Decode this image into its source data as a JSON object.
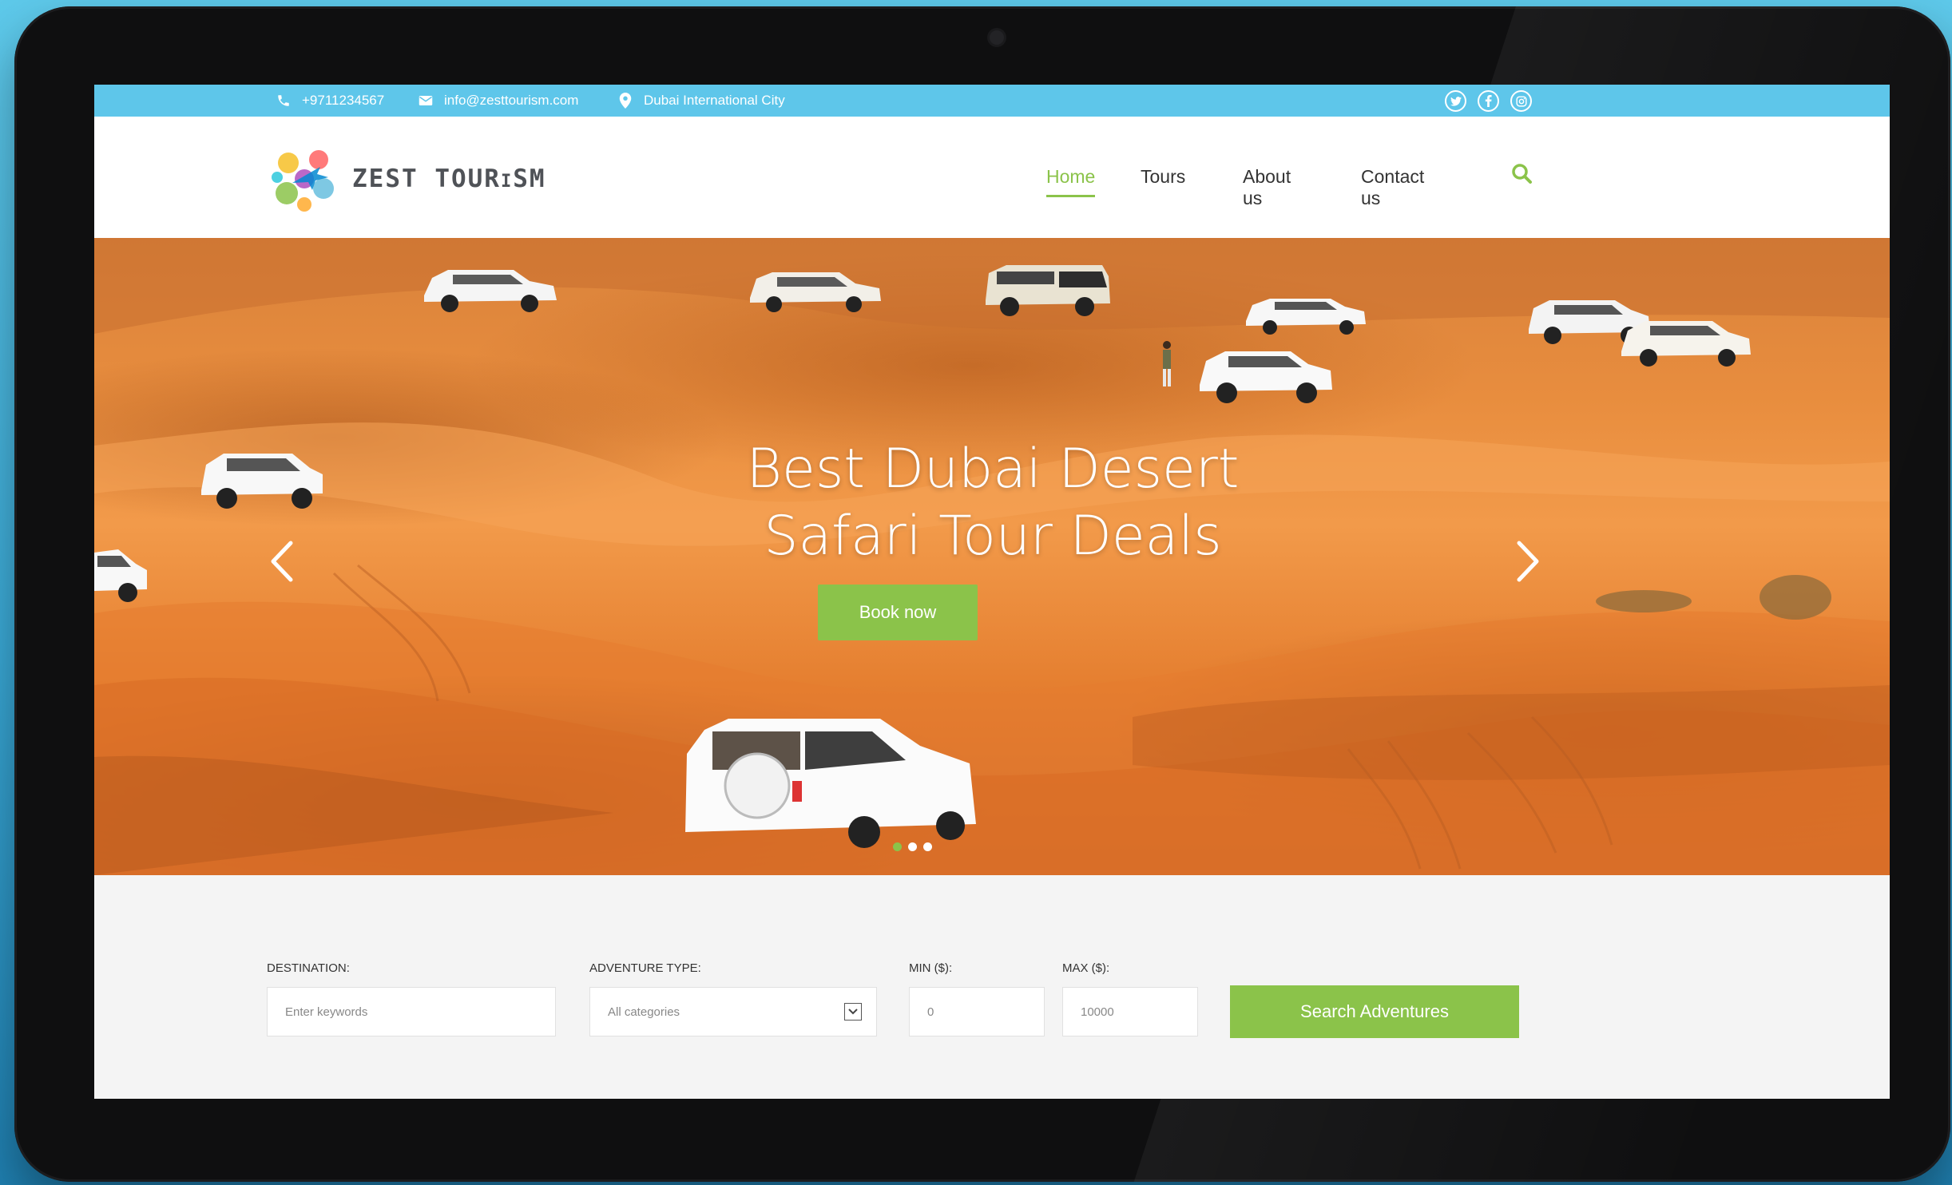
{
  "topbar": {
    "phone": "+9711234567",
    "email": "info@zesttourism.com",
    "location": "Dubai International City",
    "social": [
      "twitter-icon",
      "facebook-icon",
      "instagram-icon"
    ]
  },
  "header": {
    "logo_text": "ZEST TOURiSM"
  },
  "nav": {
    "items": [
      {
        "label": "Home",
        "active": true
      },
      {
        "label": "Tours",
        "active": false
      },
      {
        "label": "About us",
        "active": false
      },
      {
        "label": "Contact us",
        "active": false
      }
    ]
  },
  "hero": {
    "title_line1": "Best Dubai Desert",
    "title_line2": "Safari Tour Deals",
    "cta_label": "Book now",
    "slide_count": 3,
    "active_slide": 1
  },
  "search": {
    "destination_label": "DESTINATION:",
    "destination_placeholder": "Enter keywords",
    "type_label": "ADVENTURE TYPE:",
    "type_value": "All categories",
    "min_label": "MIN ($):",
    "min_value": "0",
    "max_label": "MAX ($):",
    "max_value": "10000",
    "button_label": "Search Adventures"
  },
  "colors": {
    "accent_green": "#8bc34a",
    "topbar_blue": "#5ec6ea",
    "sand": "#e88d3e"
  }
}
